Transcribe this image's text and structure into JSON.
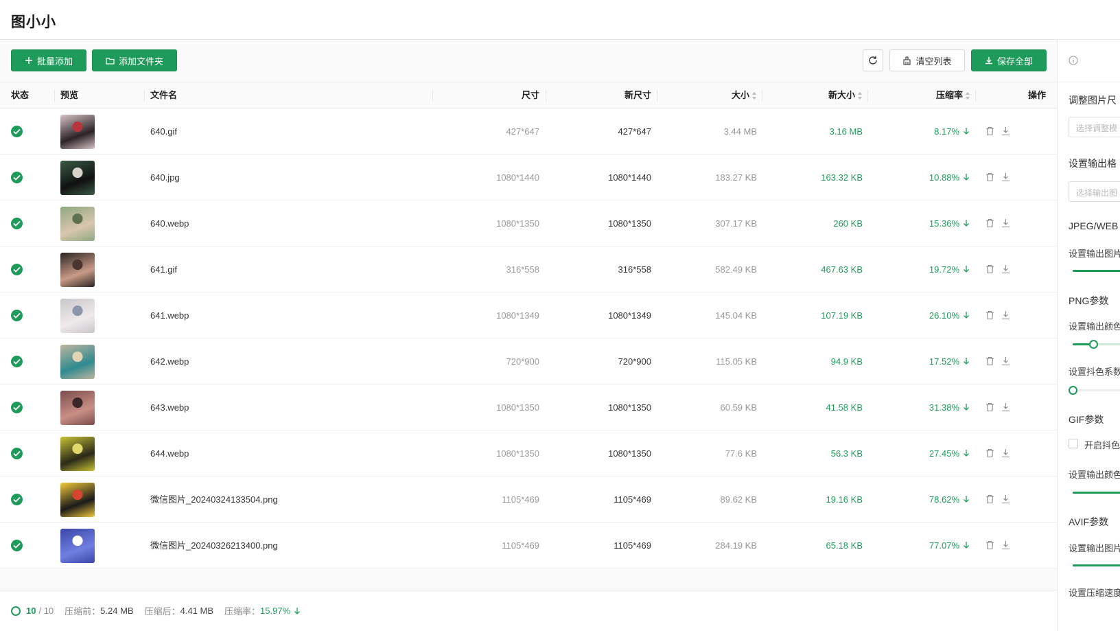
{
  "app": {
    "title": "图小小"
  },
  "toolbar": {
    "batch_add_label": "批量添加",
    "add_folder_label": "添加文件夹",
    "clear_list_label": "清空列表",
    "save_all_label": "保存全部"
  },
  "table": {
    "headers": {
      "status": "状态",
      "preview": "预览",
      "filename": "文件名",
      "dimensions": "尺寸",
      "new_dimensions": "新尺寸",
      "size": "大小",
      "new_size": "新大小",
      "ratio": "压缩率",
      "actions": "操作"
    },
    "rows": [
      {
        "filename": "640.gif",
        "dimensions": "427*647",
        "new_dimensions": "427*647",
        "size": "3.44 MB",
        "new_size": "3.16 MB",
        "ratio": "8.17%",
        "thumb": [
          "#d9c3c7",
          "#2a2326",
          "#b8353d"
        ]
      },
      {
        "filename": "640.jpg",
        "dimensions": "1080*1440",
        "new_dimensions": "1080*1440",
        "size": "183.27 KB",
        "new_size": "163.32 KB",
        "ratio": "10.88%",
        "thumb": [
          "#3a5b47",
          "#111111",
          "#d8d2cc"
        ]
      },
      {
        "filename": "640.webp",
        "dimensions": "1080*1350",
        "new_dimensions": "1080*1350",
        "size": "307.17 KB",
        "new_size": "260 KB",
        "ratio": "15.36%",
        "thumb": [
          "#8ea880",
          "#d9c6ae",
          "#5e7251"
        ]
      },
      {
        "filename": "641.gif",
        "dimensions": "316*558",
        "new_dimensions": "316*558",
        "size": "582.49 KB",
        "new_size": "467.63 KB",
        "ratio": "19.72%",
        "thumb": [
          "#2b2423",
          "#c99a86",
          "#4a3531"
        ]
      },
      {
        "filename": "641.webp",
        "dimensions": "1080*1349",
        "new_dimensions": "1080*1349",
        "size": "145.04 KB",
        "new_size": "107.19 KB",
        "ratio": "26.10%",
        "thumb": [
          "#c9c6cb",
          "#eeeaec",
          "#8f95a8"
        ]
      },
      {
        "filename": "642.webp",
        "dimensions": "720*900",
        "new_dimensions": "720*900",
        "size": "115.05 KB",
        "new_size": "94.9 KB",
        "ratio": "17.52%",
        "thumb": [
          "#bfb59f",
          "#2f8a8f",
          "#e2d3b7"
        ]
      },
      {
        "filename": "643.webp",
        "dimensions": "1080*1350",
        "new_dimensions": "1080*1350",
        "size": "60.59 KB",
        "new_size": "41.58 KB",
        "ratio": "31.38%",
        "thumb": [
          "#7a4c4b",
          "#c98f86",
          "#3a2728"
        ]
      },
      {
        "filename": "644.webp",
        "dimensions": "1080*1350",
        "new_dimensions": "1080*1350",
        "size": "77.6 KB",
        "new_size": "56.3 KB",
        "ratio": "27.45%",
        "thumb": [
          "#c8c236",
          "#2a2a18",
          "#e0d96a"
        ]
      },
      {
        "filename": "微信图片_20240324133504.png",
        "dimensions": "1105*469",
        "new_dimensions": "1105*469",
        "size": "89.62 KB",
        "new_size": "19.16 KB",
        "ratio": "78.62%",
        "thumb": [
          "#f3c93a",
          "#1a1a1a",
          "#d6452f"
        ]
      },
      {
        "filename": "微信图片_20240326213400.png",
        "dimensions": "1105*469",
        "new_dimensions": "1105*469",
        "size": "284.19 KB",
        "new_size": "65.18 KB",
        "ratio": "77.07%",
        "thumb": [
          "#3a46a8",
          "#6f7fe0",
          "#ffffff"
        ]
      }
    ]
  },
  "footer": {
    "done": "10",
    "total": "/ 10",
    "before_label": "压缩前：",
    "before_value": "5.24 MB",
    "after_label": "压缩后：",
    "after_value": "4.41 MB",
    "ratio_label": "压缩率：",
    "ratio_value": "15.97%"
  },
  "sidebar": {
    "resize_label": "调整图片尺",
    "resize_placeholder": "选择调整模",
    "format_label": "设置输出格",
    "format_placeholder": "选择输出图",
    "jpeg_webp_section": "JPEG/WEB",
    "jpeg_quality_label": "设置输出图片",
    "png_section": "PNG参数",
    "png_colors_label": "设置输出颜色",
    "png_dither_label": "设置抖色系数",
    "gif_section": "GIF参数",
    "gif_dither_label": "开启抖色",
    "gif_colors_label": "设置输出颜色",
    "avif_section": "AVIF参数",
    "avif_quality_label": "设置输出图片",
    "avif_speed_label": "设置压缩速度"
  },
  "colors": {
    "accent": "#1e9b5a"
  }
}
